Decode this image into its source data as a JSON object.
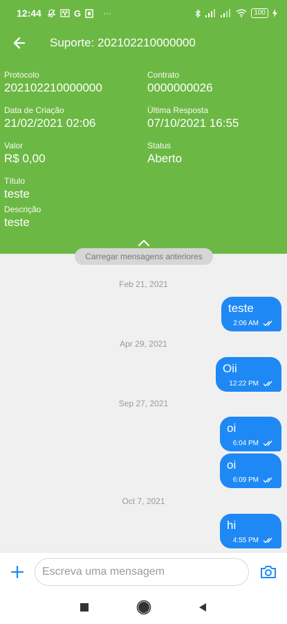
{
  "status_bar": {
    "time": "12:44",
    "left_icons": [
      "notification-off-icon",
      "wave-icon",
      "google-icon",
      "app-icon",
      "more-dots-icon"
    ],
    "more": "···",
    "battery": "100"
  },
  "app_bar": {
    "title": "Suporte: 202102210000000"
  },
  "details": {
    "protocolo": {
      "label": "Protocolo",
      "value": "202102210000000"
    },
    "contrato": {
      "label": "Contrato",
      "value": "0000000026"
    },
    "data_criacao": {
      "label": "Data de Criação",
      "value": "21/02/2021 02:06"
    },
    "ultima_resposta": {
      "label": "Última Resposta",
      "value": "07/10/2021 16:55"
    },
    "valor": {
      "label": "Valor",
      "value": "R$ 0,00"
    },
    "status": {
      "label": "Status",
      "value": "Aberto"
    },
    "titulo": {
      "label": "Título",
      "value": "teste"
    },
    "descricao": {
      "label": "Descrição",
      "value": "teste"
    }
  },
  "chat": {
    "load_more": "Carregar mensagens anteriores",
    "dates": [
      "Feb 21, 2021",
      "Apr 29, 2021",
      "Sep 27, 2021",
      "Oct 7, 2021"
    ],
    "messages": [
      {
        "text": "teste",
        "time": "2:06 AM"
      },
      {
        "text": "Oii",
        "time": "12:22 PM"
      },
      {
        "text": "oi",
        "time": "6:04 PM"
      },
      {
        "text": "oi",
        "time": "6:09 PM"
      },
      {
        "text": "hi",
        "time": "4:55 PM"
      }
    ]
  },
  "composer": {
    "placeholder": "Escreva uma mensagem"
  },
  "colors": {
    "header_green": "#6cb844",
    "bubble_blue": "#1e88f5",
    "background": "#f0f0f0"
  }
}
